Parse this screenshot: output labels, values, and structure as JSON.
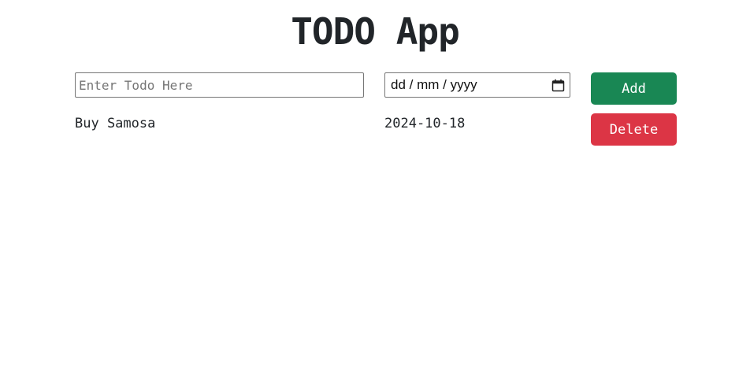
{
  "app": {
    "title": "TODO App"
  },
  "form": {
    "todo_placeholder": "Enter Todo Here",
    "todo_value": "",
    "date_placeholder": "dd / mm / yyyy",
    "calendar_icon": "calendar-icon",
    "add_label": "Add"
  },
  "todos": [
    {
      "name": "Buy Samosa",
      "date": "2024-10-18",
      "delete_label": "Delete"
    }
  ],
  "colors": {
    "add_button": "#198754",
    "delete_button": "#dc3545",
    "text": "#212529"
  }
}
